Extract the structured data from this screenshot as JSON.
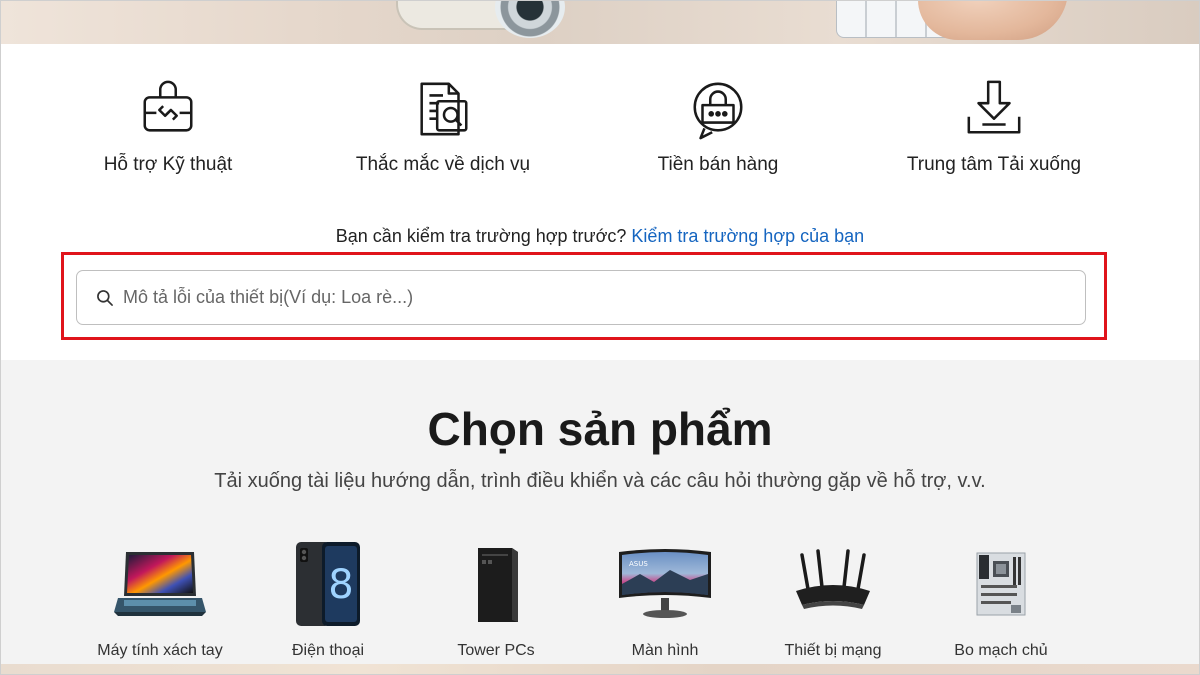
{
  "support": {
    "items": [
      {
        "label": "Hỗ trợ Kỹ thuật",
        "icon": "technical-support-icon"
      },
      {
        "label": "Thắc mắc về dịch vụ",
        "icon": "service-inquiry-icon"
      },
      {
        "label": "Tiền bán hàng",
        "icon": "pre-sales-icon"
      },
      {
        "label": "Trung tâm Tải xuống",
        "icon": "download-center-icon"
      }
    ]
  },
  "case_check": {
    "question": "Bạn cần kiểm tra trường hợp trước?",
    "link": "Kiểm tra trường hợp của bạn"
  },
  "search": {
    "placeholder": "Mô tả lỗi của thiết bị(Ví dụ: Loa rè...)",
    "icon": "search-icon"
  },
  "products": {
    "title": "Chọn sản phẩm",
    "subtitle": "Tải xuống tài liệu hướng dẫn, trình điều khiển và các câu hỏi thường gặp về hỗ trợ, v.v.",
    "items": [
      {
        "label": "Máy tính xách tay",
        "icon": "laptop-icon"
      },
      {
        "label": "Điện thoại",
        "icon": "phone-icon"
      },
      {
        "label": "Tower PCs",
        "icon": "tower-pc-icon"
      },
      {
        "label": "Màn hình",
        "icon": "monitor-icon"
      },
      {
        "label": "Thiết bị mạng",
        "icon": "router-icon"
      },
      {
        "label": "Bo mạch chủ",
        "icon": "motherboard-icon"
      }
    ]
  },
  "colors": {
    "highlight": "#e0141b",
    "link": "#1565c0",
    "section_bg": "#f3f3f3"
  }
}
